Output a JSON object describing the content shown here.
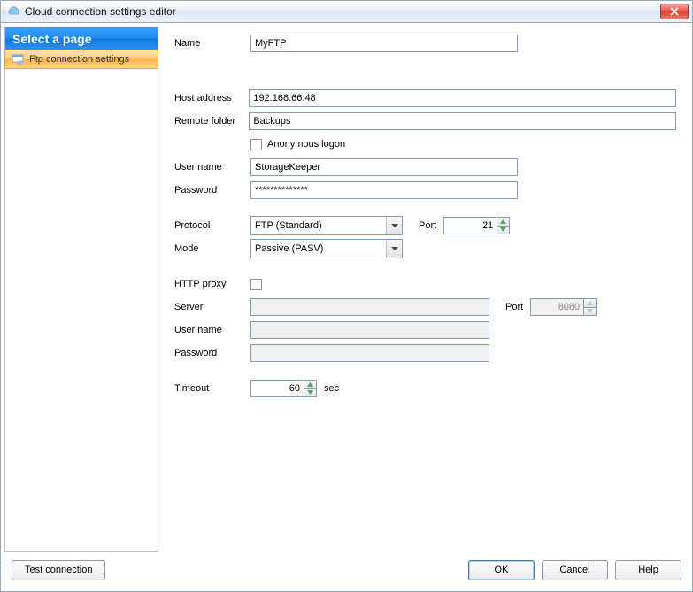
{
  "window": {
    "title": "Cloud connection settings editor"
  },
  "sidebar": {
    "heading": "Select a page",
    "item_label": "Ftp connection settings"
  },
  "labels": {
    "name": "Name",
    "host": "Host address",
    "remote_folder": "Remote folder",
    "anon": "Anonymous logon",
    "user": "User name",
    "password": "Password",
    "protocol": "Protocol",
    "port": "Port",
    "mode": "Mode",
    "http_proxy": "HTTP proxy",
    "server": "Server",
    "proxy_user": "User name",
    "proxy_password": "Password",
    "timeout": "Timeout",
    "sec": "sec"
  },
  "fields": {
    "name": "MyFTP",
    "host": "192.168.66.48",
    "remote_folder": "Backups",
    "anonymous": false,
    "user": "StorageKeeper",
    "password": "**************",
    "protocol": "FTP (Standard)",
    "ftp_port": "21",
    "mode": "Passive (PASV)",
    "http_proxy": false,
    "server": "",
    "proxy_port": "8080",
    "proxy_user": "",
    "proxy_password": "",
    "timeout": "60"
  },
  "buttons": {
    "test": "Test connection",
    "ok": "OK",
    "cancel": "Cancel",
    "help": "Help"
  }
}
